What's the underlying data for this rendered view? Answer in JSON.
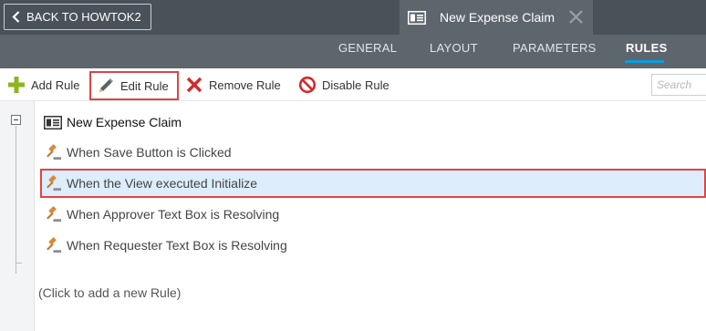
{
  "header": {
    "back_label": "BACK TO HOWTOK2",
    "document_tab": "New Expense Claim"
  },
  "nav": {
    "tabs": [
      "GENERAL",
      "LAYOUT",
      "PARAMETERS",
      "RULES"
    ],
    "active": "RULES"
  },
  "toolbar": {
    "add": "Add Rule",
    "edit": "Edit Rule",
    "remove": "Remove Rule",
    "disable": "Disable Rule",
    "search_placeholder": "Search"
  },
  "tree": {
    "root": "New Expense Claim",
    "rules": [
      "When Save Button is Clicked",
      "When the View executed Initialize",
      "When Approver Text Box is Resolving",
      "When Requester Text Box is Resolving"
    ],
    "selected_index": 1,
    "add_hint": "(Click to add a new Rule)"
  },
  "colors": {
    "topbar": "#4a5259",
    "navbar": "#5e666d",
    "active_underline": "#0a9de0",
    "highlight_border": "#e04343",
    "selected_row": "#ddedfb"
  }
}
